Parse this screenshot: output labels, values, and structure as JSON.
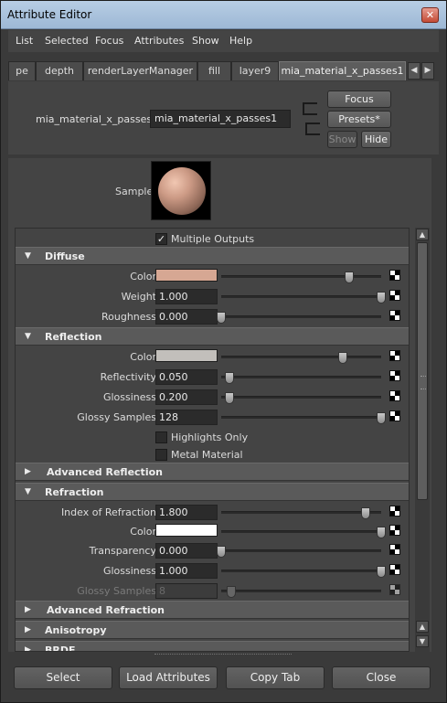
{
  "window": {
    "title": "Attribute Editor",
    "close_label": "✕"
  },
  "menu": [
    "List",
    "Selected",
    "Focus",
    "Attributes",
    "Show",
    "Help"
  ],
  "tabs": [
    "pe",
    "depth",
    "renderLayerManager",
    "fill",
    "layer9",
    "mia_material_x_passes1"
  ],
  "tab_selected": "mia_material_x_passes1",
  "tab_arrows": [
    "◀",
    "▶"
  ],
  "header": {
    "node_label": "mia_material_x_passes:",
    "node_value": "mia_material_x_passes1",
    "focus_label": "Focus",
    "presets_label": "Presets*",
    "show_label": "Show",
    "hide_label": "Hide"
  },
  "sample": {
    "label": "Sample"
  },
  "multiple_outputs": {
    "label": "Multiple Outputs",
    "checked": true,
    "mark": "✓"
  },
  "sections": {
    "diffuse": {
      "title": "Diffuse",
      "arrow": "▼",
      "color": {
        "label": "Color",
        "swatch": "#d6a793",
        "level": 0.8
      },
      "weight": {
        "label": "Weight",
        "value": "1.000",
        "level": 1.0
      },
      "roughness": {
        "label": "Roughness",
        "value": "0.000",
        "level": 0.0
      }
    },
    "reflection": {
      "title": "Reflection",
      "arrow": "▼",
      "color": {
        "label": "Color",
        "swatch": "#c2bfbb",
        "level": 0.76
      },
      "reflectivity": {
        "label": "Reflectivity",
        "value": "0.050",
        "level": 0.05
      },
      "glossiness": {
        "label": "Glossiness",
        "value": "0.200",
        "level": 0.05
      },
      "glossy_samples": {
        "label": "Glossy Samples",
        "value": "128",
        "level": 1.0
      },
      "highlights_only": {
        "label": "Highlights Only",
        "checked": false
      },
      "metal_material": {
        "label": "Metal Material",
        "checked": false
      }
    },
    "advanced_reflection": {
      "title": "Advanced Reflection",
      "arrow": "▶"
    },
    "refraction": {
      "title": "Refraction",
      "arrow": "▼",
      "ior": {
        "label": "Index of Refraction",
        "value": "1.800",
        "level": 0.9
      },
      "color": {
        "label": "Color",
        "swatch": "#ffffff",
        "level": 1.0
      },
      "transparency": {
        "label": "Transparency",
        "value": "0.000",
        "level": 0.0
      },
      "glossiness": {
        "label": "Glossiness",
        "value": "1.000",
        "level": 1.0
      },
      "glossy_samples": {
        "label": "Glossy Samples",
        "value": "8",
        "level": 0.06
      }
    },
    "advanced_refraction": {
      "title": "Advanced Refraction",
      "arrow": "▶"
    },
    "anisotropy": {
      "title": "Anisotropy",
      "arrow": "▶"
    },
    "brdf": {
      "title": "BRDF",
      "arrow": "▶"
    }
  },
  "scroll_arrows": {
    "up": "▲",
    "down": "▼"
  },
  "bottom_buttons": {
    "select": "Select",
    "load": "Load Attributes",
    "copy": "Copy Tab",
    "close": "Close"
  }
}
